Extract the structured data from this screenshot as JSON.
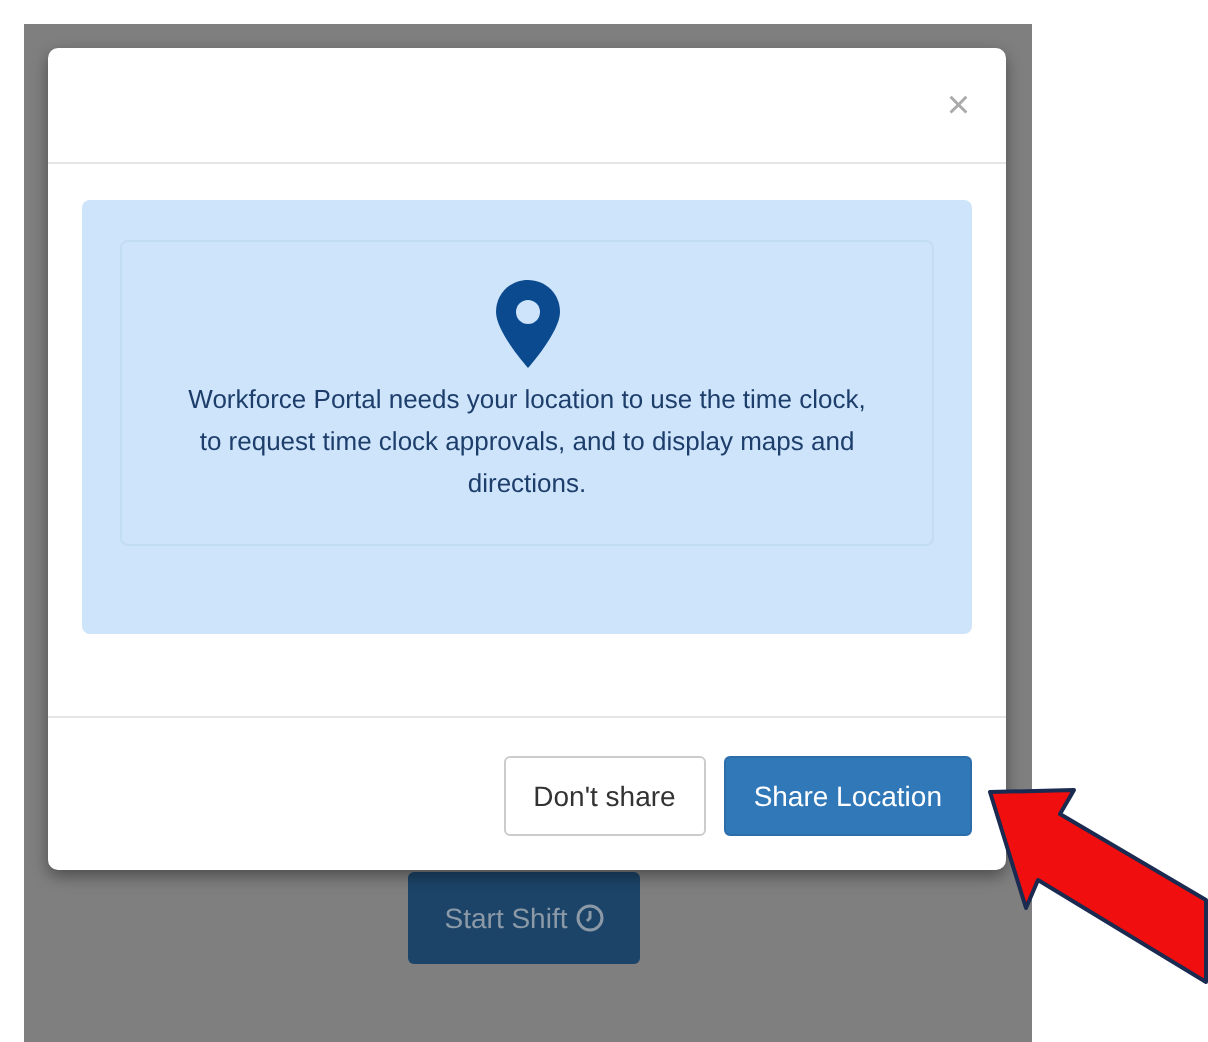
{
  "background": {
    "button": {
      "label": "Start Shift"
    }
  },
  "dialog": {
    "close": "×",
    "message": "Workforce Portal needs your location to use the time clock, to request time clock approvals, and to display maps and directions.",
    "buttons": [
      {
        "label": "Don't share",
        "kind": "secondary"
      },
      {
        "label": "Share Location",
        "kind": "primary"
      }
    ]
  },
  "annotation": {
    "kind": "arrow"
  }
}
